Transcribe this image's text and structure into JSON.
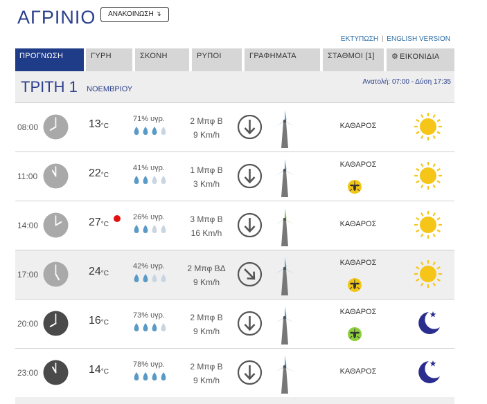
{
  "header": {
    "city": "ΑΓΡΙΝΙΟ",
    "announce_label": "ΑΝΑΚΟΙΝΩΣΗ ↴",
    "print_link": "ΕΚΤΥΠΩΣΗ",
    "separator": "|",
    "english_link": "ENGLISH VERSION"
  },
  "tabs": [
    {
      "label": "ΠΡΟΓΝΩΣΗ",
      "active": true
    },
    {
      "label": "ΓΥΡΗ",
      "active": false
    },
    {
      "label": "ΣΚΟΝΗ",
      "active": false
    },
    {
      "label": "ΡΥΠΟΙ",
      "active": false
    },
    {
      "label": "ΓΡΑΦΗΜΑΤΑ",
      "active": false
    },
    {
      "label": "ΣΤΑΘΜΟΙ [1]",
      "active": false
    },
    {
      "label": "ΕΙΚΟΝΙΔΙΑ",
      "active": false,
      "icon": "gear-icon"
    }
  ],
  "day": {
    "name": "ΤΡΙΤΗ 1",
    "month": "ΝΟΕΜΒΡΙΟΥ",
    "sun_times": "Ανατολή: 07:00  - Δύση 17:35"
  },
  "colors": {
    "brand_blue": "#1f3c88",
    "icon_blue": "#5a9ac6",
    "sun_yellow": "#f5c518",
    "moon_navy": "#2a2d8e",
    "hot_red": "#e31010"
  },
  "forecast": [
    {
      "time": "08:00",
      "hour": 8,
      "clock_style": "light",
      "temp": "13",
      "unit": "°C",
      "hot": false,
      "humidity": "71% υγρ.",
      "drops_filled": 3,
      "wind_force": "2 Μπφ Β",
      "wind_speed": "9 Km/h",
      "wind_direction": "N",
      "windmill_color": "blue",
      "sky": "ΚΑΘΑΡΟΣ",
      "insect_icon": null,
      "weather_icon": "sun-icon"
    },
    {
      "time": "11:00",
      "hour": 11,
      "clock_style": "light",
      "temp": "22",
      "unit": "°C",
      "hot": false,
      "humidity": "41% υγρ.",
      "drops_filled": 2,
      "wind_force": "1 Μπφ Β",
      "wind_speed": "3 Km/h",
      "wind_direction": "N",
      "windmill_color": "blue",
      "sky": "ΚΑΘΑΡΟΣ",
      "insect_icon": "mosquito-yellow-icon",
      "weather_icon": "sun-icon"
    },
    {
      "time": "14:00",
      "hour": 14,
      "clock_style": "light",
      "temp": "27",
      "unit": "°C",
      "hot": true,
      "humidity": "26% υγρ.",
      "drops_filled": 2,
      "wind_force": "3 Μπφ Β",
      "wind_speed": "16 Km/h",
      "wind_direction": "N",
      "windmill_color": "green",
      "sky": "ΚΑΘΑΡΟΣ",
      "insect_icon": null,
      "weather_icon": "sun-icon"
    },
    {
      "time": "17:00",
      "hour": 17,
      "clock_style": "light",
      "temp": "24",
      "unit": "°C",
      "hot": false,
      "humidity": "42% υγρ.",
      "drops_filled": 2,
      "wind_force": "2 Μπφ ΒΔ",
      "wind_speed": "9 Km/h",
      "wind_direction": "NW",
      "windmill_color": "blue",
      "sky": "ΚΑΘΑΡΟΣ",
      "insect_icon": "mosquito-yellow-icon",
      "weather_icon": "sun-icon"
    },
    {
      "time": "20:00",
      "hour": 20,
      "clock_style": "dark",
      "temp": "16",
      "unit": "°C",
      "hot": false,
      "humidity": "73% υγρ.",
      "drops_filled": 3,
      "wind_force": "2 Μπφ Β",
      "wind_speed": "9 Km/h",
      "wind_direction": "N",
      "windmill_color": "blue",
      "sky": "ΚΑΘΑΡΟΣ",
      "insect_icon": "mosquito-green-icon",
      "weather_icon": "moon-icon"
    },
    {
      "time": "23:00",
      "hour": 23,
      "clock_style": "dark",
      "temp": "14",
      "unit": "°C",
      "hot": false,
      "humidity": "78% υγρ.",
      "drops_filled": 4,
      "wind_force": "2 Μπφ Β",
      "wind_speed": "9 Km/h",
      "wind_direction": "N",
      "windmill_color": "blue",
      "sky": "ΚΑΘΑΡΟΣ",
      "insect_icon": null,
      "weather_icon": "moon-icon"
    }
  ]
}
